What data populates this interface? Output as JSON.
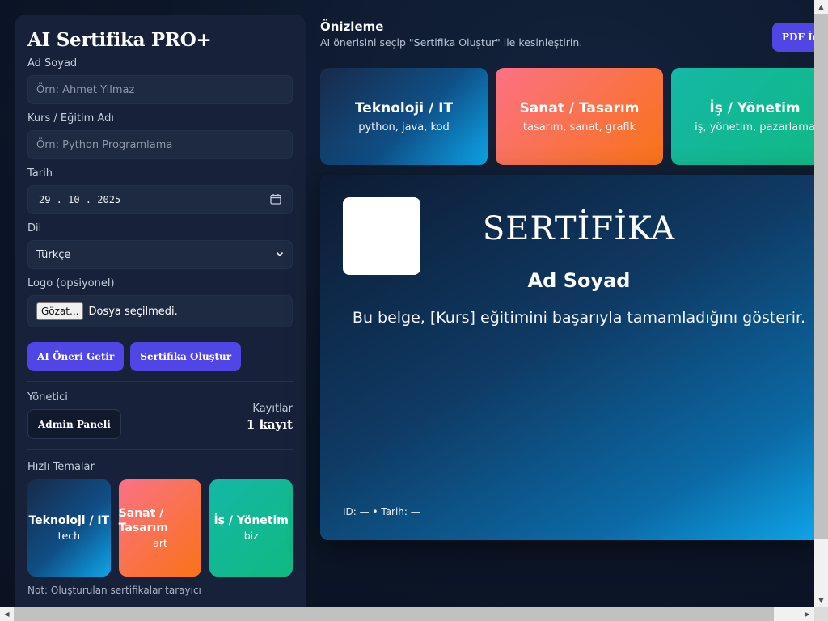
{
  "app": {
    "title": "AI Sertifika PRO+"
  },
  "form": {
    "name_label": "Ad Soyad",
    "name_placeholder": "Örn: Ahmet Yilmaz",
    "course_label": "Kurs / Eğitim Adı",
    "course_placeholder": "Örn: Python Programlama",
    "date_label": "Tarih",
    "date_value": "29 . 10 . 2025",
    "lang_label": "Dil",
    "lang_value": "Türkçe",
    "logo_label": "Logo (opsiyonel)",
    "file_button": "Gözat...",
    "file_status": "Dosya seçilmedi."
  },
  "actions": {
    "ai_suggest": "AI Öneri Getir",
    "create": "Sertifika Oluştur"
  },
  "admin": {
    "label": "Yönetici",
    "panel_button": "Admin Paneli",
    "records_label": "Kayıtlar",
    "records_value": "1 kayıt"
  },
  "quick_themes": {
    "label": "Hızlı Temalar",
    "items": [
      {
        "title": "Teknoloji / IT",
        "sub": "tech"
      },
      {
        "title": "Sanat / Tasarım",
        "sub": "art"
      },
      {
        "title": "İş / Yönetim",
        "sub": "biz"
      }
    ],
    "note": "Not: Oluşturulan sertifikalar tarayıcı"
  },
  "preview": {
    "title": "Önizleme",
    "subtitle": "AI önerisini seçip \"Sertifika Oluştur\" ile kesinleştirin.",
    "pdf_button": "PDF İn"
  },
  "themes": [
    {
      "title": "Teknoloji / IT",
      "tags": "python, java, kod"
    },
    {
      "title": "Sanat / Tasarım",
      "tags": "tasarım, sanat, grafik"
    },
    {
      "title": "İş / Yönetim",
      "tags": "iş, yönetim, pazarlama"
    }
  ],
  "certificate": {
    "heading": "SERTİFİKA",
    "name": "Ad Soyad",
    "body": "Bu belge, [Kurs] eğitimini başarıyla tamamladığını gösterir.",
    "footer": "ID: — • Tarih: —"
  },
  "colors": {
    "accent": "#4f46e5",
    "panel": "#17223a",
    "tech_gradient": [
      "#182a4a",
      "#0ea5e9"
    ],
    "art_gradient": [
      "#fb7185",
      "#f97316"
    ],
    "biz_gradient": [
      "#14b8a6",
      "#10b981"
    ]
  }
}
